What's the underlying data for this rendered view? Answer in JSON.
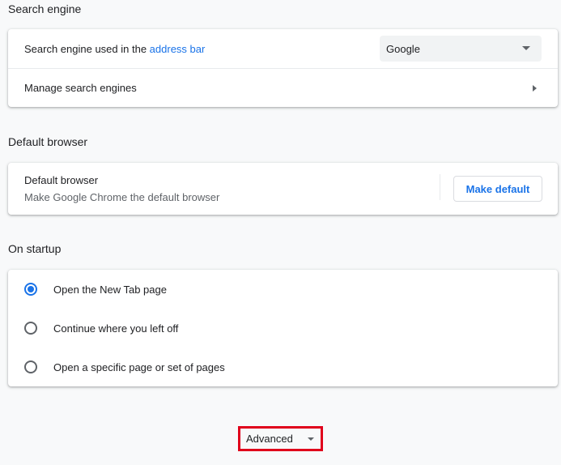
{
  "search_engine": {
    "title": "Search engine",
    "used_in_label": "Search engine used in the ",
    "used_in_link": "address bar",
    "selected": "Google",
    "manage_label": "Manage search engines"
  },
  "default_browser": {
    "title": "Default browser",
    "row_title": "Default browser",
    "row_subtitle": "Make Google Chrome the default browser",
    "button_label": "Make default"
  },
  "on_startup": {
    "title": "On startup",
    "options": [
      {
        "label": "Open the New Tab page",
        "checked": true
      },
      {
        "label": "Continue where you left off",
        "checked": false
      },
      {
        "label": "Open a specific page or set of pages",
        "checked": false
      }
    ]
  },
  "advanced": {
    "label": "Advanced",
    "highlight_color": "#e0001b"
  },
  "colors": {
    "accent": "#1a73e8",
    "background": "#f8f9fa",
    "text": "#202124",
    "secondary_text": "#5f6368"
  }
}
